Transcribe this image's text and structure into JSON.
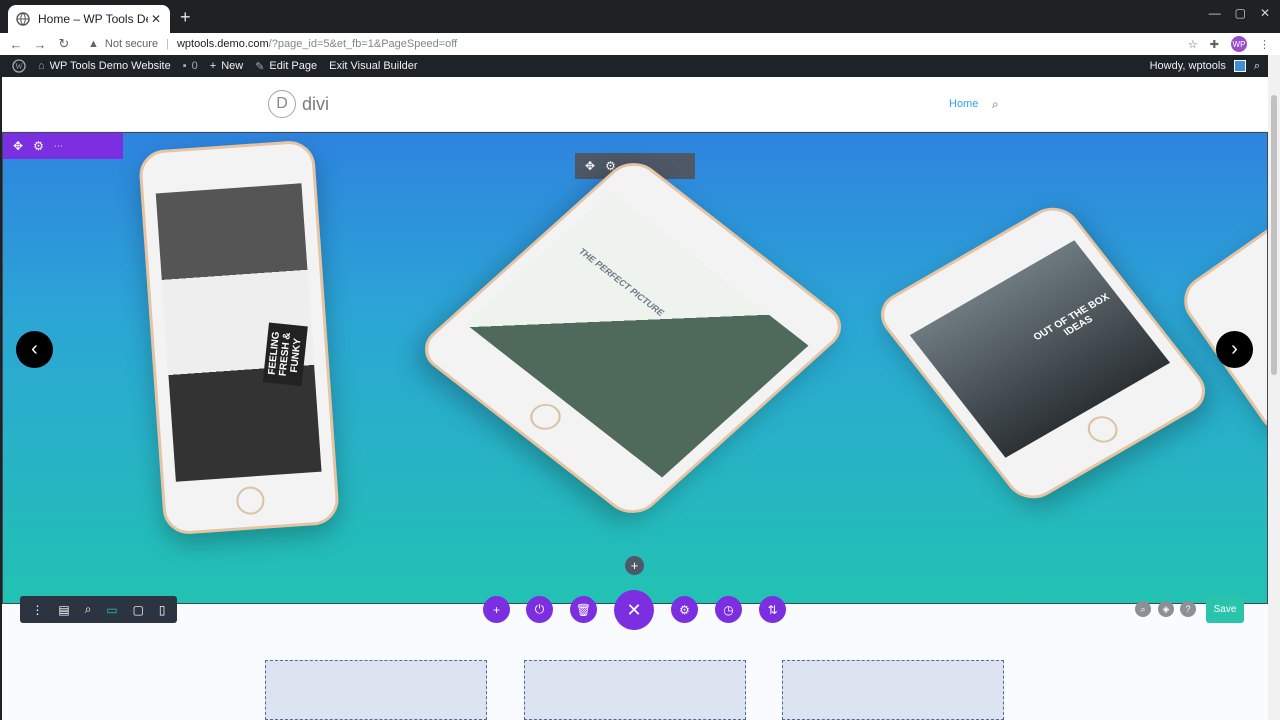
{
  "browser": {
    "tab_title": "Home – WP Tools Demo",
    "tab_close": "✕",
    "new_tab": "+",
    "security_label": "Not secure",
    "url_host": "wptools.demo.com",
    "url_rest": "/?page_id=5&et_fb=1&PageSpeed=off",
    "profile_initials": "WP"
  },
  "admin_bar": {
    "site_name": "WP Tools Demo Website",
    "comments_count": "0",
    "new_label": "New",
    "edit_label": "Edit Page",
    "exit_label": "Exit Visual Builder",
    "howdy": "Howdy, wptools"
  },
  "site": {
    "logo_letter": "D",
    "logo_text": "divi",
    "nav_home": "Home"
  },
  "slider": {
    "phone1_text": "FEELING FRESH & FUNKY",
    "phone2_text": "THE PERFECT PICTURE",
    "phone3_text": "OUT OF THE BOX IDEAS"
  },
  "builder": {
    "save_label": "Save"
  },
  "colors": {
    "divi_purple": "#7b2fe0",
    "save_green": "#29c4a9",
    "wp_admin": "#1d2327"
  }
}
